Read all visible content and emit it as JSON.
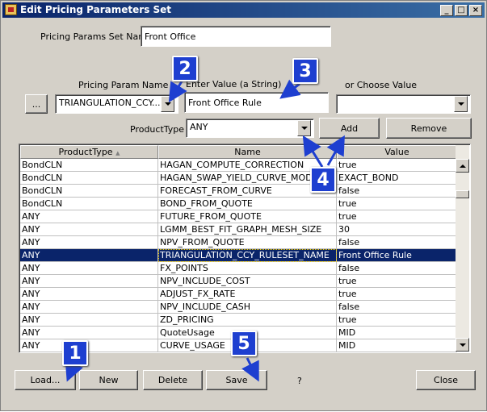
{
  "window": {
    "title": "Edit Pricing Parameters Set",
    "controls": {
      "minimize": "_",
      "maximize": "□",
      "close": "×"
    }
  },
  "form": {
    "set_name_label": "Pricing Params Set Name",
    "set_name_value": "Front Office",
    "param_name_label": "Pricing Param Name",
    "param_name_value": "TRIANGULATION_CCY...",
    "browse_label": "...",
    "enter_value_label": "Enter Value (a String)",
    "enter_value_value": "Front Office Rule",
    "choose_value_label": "or Choose Value",
    "choose_value_value": "",
    "product_type_label": "ProductType",
    "product_type_value": "ANY",
    "add_label": "Add",
    "remove_label": "Remove"
  },
  "table": {
    "columns": [
      "ProductType",
      "Name",
      "Value"
    ],
    "sort_indicator": "▲",
    "rows": [
      {
        "product": "BondCLN",
        "name": "HAGAN_COMPUTE_CORRECTION",
        "value": "true"
      },
      {
        "product": "BondCLN",
        "name": "HAGAN_SWAP_YIELD_CURVE_MODEL",
        "value": "EXACT_BOND"
      },
      {
        "product": "BondCLN",
        "name": "FORECAST_FROM_CURVE",
        "value": "false"
      },
      {
        "product": "BondCLN",
        "name": "BOND_FROM_QUOTE",
        "value": "true"
      },
      {
        "product": "ANY",
        "name": "FUTURE_FROM_QUOTE",
        "value": "true"
      },
      {
        "product": "ANY",
        "name": "LGMM_BEST_FIT_GRAPH_MESH_SIZE",
        "value": "30"
      },
      {
        "product": "ANY",
        "name": "NPV_FROM_QUOTE",
        "value": "false"
      },
      {
        "product": "ANY",
        "name": "TRIANGULATION_CCY_RULESET_NAME",
        "value": "Front Office Rule"
      },
      {
        "product": "ANY",
        "name": "FX_POINTS",
        "value": "false"
      },
      {
        "product": "ANY",
        "name": "NPV_INCLUDE_COST",
        "value": "true"
      },
      {
        "product": "ANY",
        "name": "ADJUST_FX_RATE",
        "value": "true"
      },
      {
        "product": "ANY",
        "name": "NPV_INCLUDE_CASH",
        "value": "false"
      },
      {
        "product": "ANY",
        "name": "ZD_PRICING",
        "value": "true"
      },
      {
        "product": "ANY",
        "name": "QuoteUsage",
        "value": "MID"
      },
      {
        "product": "ANY",
        "name": "CURVE_USAGE",
        "value": "MID"
      }
    ],
    "selected_row": 7
  },
  "footer": {
    "load_label": "Load...",
    "new_label": "New",
    "delete_label": "Delete",
    "save_label": "Save",
    "help_label": "?",
    "close_label": "Close"
  },
  "callouts": [
    "1",
    "2",
    "3",
    "4",
    "5"
  ],
  "colors": {
    "callout_fill": "#1e3fd0",
    "selection": "#0a246a",
    "titlebar": "#0a246a"
  }
}
